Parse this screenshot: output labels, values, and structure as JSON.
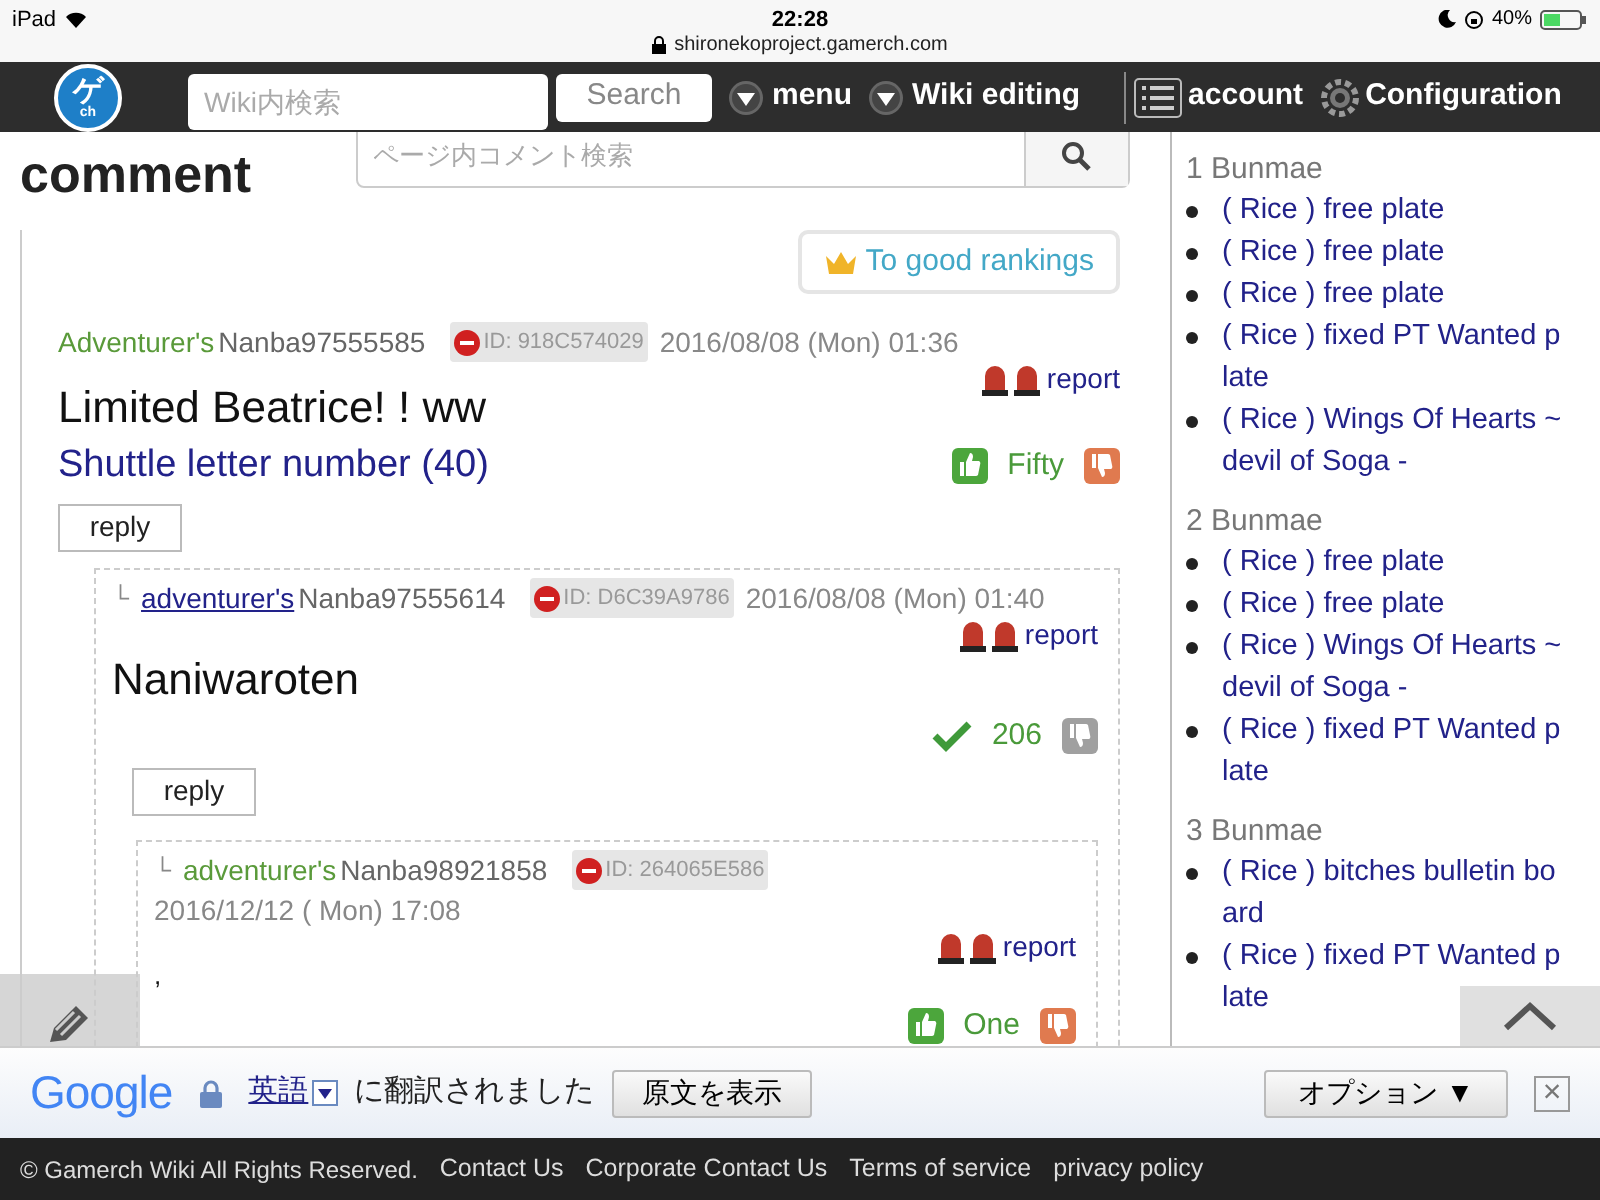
{
  "status_bar": {
    "device": "iPad",
    "time": "22:28",
    "url": "shironekoproject.gamerch.com",
    "battery": "40%"
  },
  "nav": {
    "logo_mark": "ゲ",
    "logo_sub": "ch",
    "search_placeholder": "Wiki内検索",
    "search_button": "Search",
    "menu": "menu",
    "wiki_editing": "Wiki editing",
    "account": "account",
    "configuration": "Configuration"
  },
  "comments_section": {
    "title": "comment",
    "search_placeholder": "ページ内コメント検索",
    "ranking_button": "To good rankings"
  },
  "comments": [
    {
      "author_label": "Adventurer's",
      "underlined": false,
      "name": "Nanba97555585",
      "id": "ID: 918C574029",
      "date": "2016/08/08 (Mon) 01:36",
      "report": "report",
      "body": "Limited Beatrice! ! ww",
      "link": "Shuttle letter number (40)",
      "voted": false,
      "votes": "Fifty",
      "reply": "reply",
      "children": [
        {
          "prefix": "└",
          "author_label": "adventurer's",
          "underlined": true,
          "name": "Nanba97555614",
          "id": "ID: D6C39A9786",
          "date": "2016/08/08 (Mon) 01:40",
          "report": "report",
          "body": "Naniwaroten",
          "voted": true,
          "votes": "206",
          "reply": "reply",
          "children": [
            {
              "prefix": "└",
              "author_label": "adventurer's",
              "underlined": false,
              "name": "Nanba98921858",
              "id": "ID: 264065E586",
              "date": "2016/12/12 ( Mon) 17:08",
              "report": "report",
              "body": ",",
              "voted": false,
              "votes": "One"
            }
          ]
        }
      ]
    }
  ],
  "sidebar": {
    "sections": [
      {
        "heading": "1 Bunmae",
        "items": [
          "( Rice ) free plate",
          "( Rice ) free plate",
          "( Rice ) free plate",
          "( Rice ) fixed PT Wanted plate",
          "( Rice ) Wings Of Hearts ~ devil of Soga -"
        ]
      },
      {
        "heading": "2 Bunmae",
        "items": [
          "( Rice ) free plate",
          "( Rice ) free plate",
          "( Rice ) Wings Of Hearts ~ devil of Soga -",
          "( Rice ) fixed PT Wanted plate"
        ]
      },
      {
        "heading": "3 Bunmae",
        "items": [
          "( Rice ) bitches bulletin board",
          "( Rice ) fixed PT Wanted plate"
        ]
      }
    ]
  },
  "translate_bar": {
    "brand": "Google",
    "language": "英語",
    "message": "に翻訳されました",
    "show_original": "原文を表示",
    "options": "オプション ▼",
    "close": "×"
  },
  "footer": {
    "links": [
      "© Gamerch Wiki All Rights Reserved.",
      "Contact Us",
      "Corporate Contact Us",
      "Terms of service",
      "privacy policy"
    ]
  }
}
